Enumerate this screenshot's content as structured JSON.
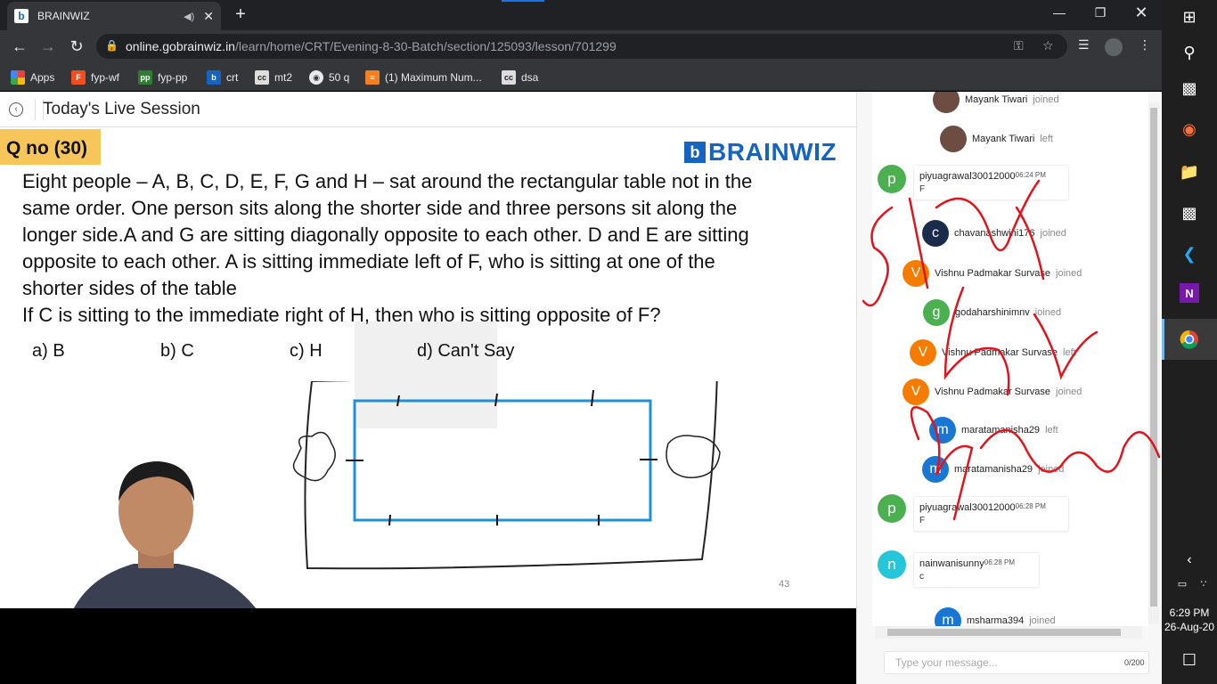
{
  "browser": {
    "tab_title": "BRAINWIZ",
    "url_host": "online.gobrainwiz.in",
    "url_path": "/learn/home/CRT/Evening-8-30-Batch/section/125093/lesson/701299",
    "bookmarks": [
      "Apps",
      "fyp-wf",
      "fyp-pp",
      "crt",
      "mt2",
      "50 q",
      "(1) Maximum Num...",
      "dsa"
    ]
  },
  "page": {
    "title": "Today's Live Session"
  },
  "slide": {
    "qno": "Q no (30)",
    "brand": "BRAINWIZ",
    "question_lines": [
      "Eight people – A, B, C, D, E, F, G and H – sat around the rectangular table not in the",
      "same order. One person sits along the shorter side and three persons sit along the",
      "longer side.A and G are sitting diagonally opposite to each other. D and E are sitting",
      "opposite to each other. A is sitting immediate left of F, who is sitting at one of the",
      "shorter sides of the table"
    ],
    "ask": "If C is sitting to the immediate right of H, then who is sitting opposite of F?",
    "options": [
      "a) B",
      "b) C",
      "c) H",
      "d) Can't Say"
    ],
    "page_number": "43"
  },
  "chat": {
    "events": [
      {
        "name": "Mayank Tiwari",
        "action": "joined",
        "initial": "",
        "color": "#555555"
      },
      {
        "name": "Mayank Tiwari",
        "action": "left",
        "initial": "",
        "color": "#555555"
      },
      {
        "name": "chavanashwini176",
        "action": "joined",
        "initial": "c",
        "color": "#1a2b4c"
      },
      {
        "name": "Vishnu Padmakar Survase",
        "action": "joined",
        "initial": "V",
        "color": "#f57c00"
      },
      {
        "name": "godaharshinimnv",
        "action": "joined",
        "initial": "g",
        "color": "#4caf50"
      },
      {
        "name": "Vishnu Padmakar Survase",
        "action": "left",
        "initial": "V",
        "color": "#f57c00"
      },
      {
        "name": "Vishnu Padmakar Survase",
        "action": "joined",
        "initial": "V",
        "color": "#f57c00"
      },
      {
        "name": "maratamanisha29",
        "action": "left",
        "initial": "m",
        "color": "#1976d2"
      },
      {
        "name": "maratamanisha29",
        "action": "joined",
        "initial": "m",
        "color": "#1976d2"
      },
      {
        "name": "msharma394",
        "action": "joined",
        "initial": "m",
        "color": "#1976d2"
      }
    ],
    "messages": [
      {
        "user": "piyuagrawal30012000",
        "time": "06:24 PM",
        "text": "F",
        "initial": "p",
        "color": "#4caf50"
      },
      {
        "user": "piyuagrawal30012000",
        "time": "06:28 PM",
        "text": "F",
        "initial": "p",
        "color": "#4caf50"
      },
      {
        "user": "nainwanisunny",
        "time": "06:28 PM",
        "text": "c",
        "initial": "n",
        "color": "#26c6da"
      }
    ],
    "input_placeholder": "Type your message...",
    "counter": "0/200"
  },
  "taskbar": {
    "time": "6:29 PM",
    "date": "26-Aug-20"
  }
}
